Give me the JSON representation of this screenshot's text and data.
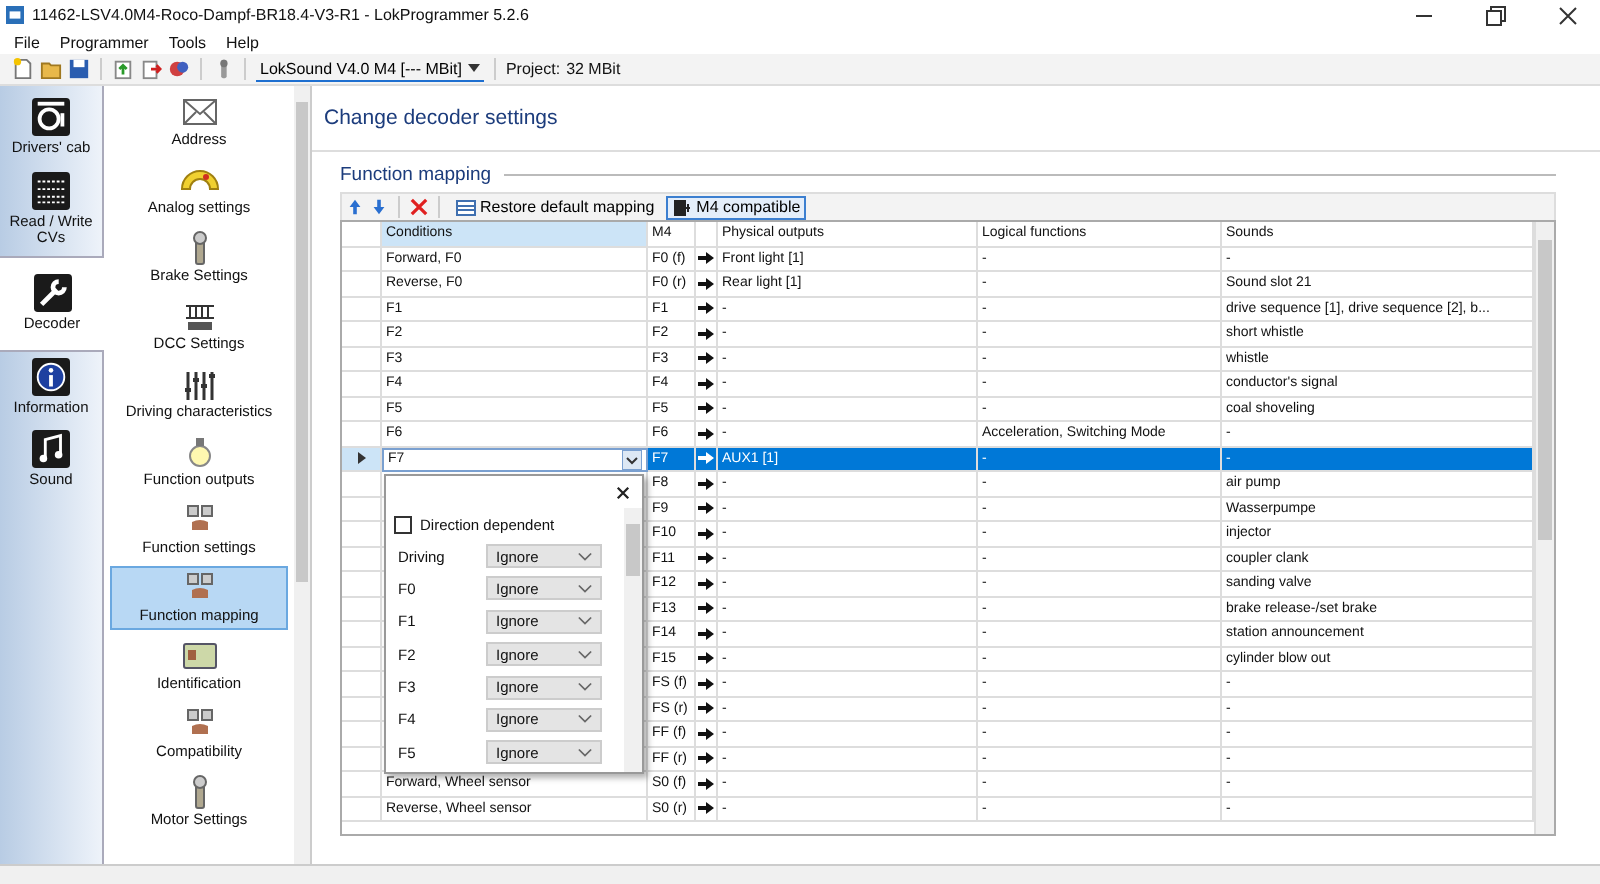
{
  "window": {
    "title": "11462-LSV4.0M4-Roco-Dampf-BR18.4-V3-R1 - LokProgrammer 5.2.6"
  },
  "menu": [
    "File",
    "Programmer",
    "Tools",
    "Help"
  ],
  "toolbar": {
    "decoder": "LokSound V4.0 M4 [--- MBit]",
    "project_label": "Project:",
    "project_value": "32 MBit"
  },
  "nav": [
    {
      "label": "Drivers' cab",
      "selected": false
    },
    {
      "label": "Read / Write CVs",
      "selected": false
    },
    {
      "label": "Decoder",
      "selected": true
    },
    {
      "label": "Information",
      "selected": false
    },
    {
      "label": "Sound",
      "selected": false
    }
  ],
  "categories": [
    {
      "label": "Address",
      "selected": false
    },
    {
      "label": "Analog settings",
      "selected": false
    },
    {
      "label": "Brake Settings",
      "selected": false
    },
    {
      "label": "DCC Settings",
      "selected": false
    },
    {
      "label": "Driving characteristics",
      "selected": false
    },
    {
      "label": "Function outputs",
      "selected": false
    },
    {
      "label": "Function settings",
      "selected": false
    },
    {
      "label": "Function mapping",
      "selected": true
    },
    {
      "label": "Identification",
      "selected": false
    },
    {
      "label": "Compatibility",
      "selected": false
    },
    {
      "label": "Motor Settings",
      "selected": false
    }
  ],
  "page_title": "Change decoder settings",
  "section_title": "Function mapping",
  "mapping_toolbar": {
    "restore": "Restore default mapping",
    "m4_compatible": {
      "label": "M4 compatible",
      "pressed": true
    }
  },
  "table": {
    "columns": [
      "Conditions",
      "M4",
      "Physical outputs",
      "Logical functions",
      "Sounds"
    ],
    "rows": [
      {
        "conditions": "Forward, F0",
        "m4": "F0 (f)",
        "physical": "Front light [1]",
        "logical": "-",
        "sounds": "-",
        "selected": false
      },
      {
        "conditions": "Reverse, F0",
        "m4": "F0 (r)",
        "physical": "Rear light [1]",
        "logical": "-",
        "sounds": "Sound slot 21",
        "selected": false
      },
      {
        "conditions": "F1",
        "m4": "F1",
        "physical": "-",
        "logical": "-",
        "sounds": "drive sequence [1], drive sequence [2], b...",
        "selected": false
      },
      {
        "conditions": "F2",
        "m4": "F2",
        "physical": "-",
        "logical": "-",
        "sounds": "short whistle",
        "selected": false
      },
      {
        "conditions": "F3",
        "m4": "F3",
        "physical": "-",
        "logical": "-",
        "sounds": "whistle",
        "selected": false
      },
      {
        "conditions": "F4",
        "m4": "F4",
        "physical": "-",
        "logical": "-",
        "sounds": "conductor's signal",
        "selected": false
      },
      {
        "conditions": "F5",
        "m4": "F5",
        "physical": "-",
        "logical": "-",
        "sounds": "coal shoveling",
        "selected": false
      },
      {
        "conditions": "F6",
        "m4": "F6",
        "physical": "-",
        "logical": "Acceleration, Switching Mode",
        "sounds": "-",
        "selected": false
      },
      {
        "conditions": "F7",
        "m4": "F7",
        "physical": "AUX1 [1]",
        "logical": "-",
        "sounds": "-",
        "selected": true
      },
      {
        "m4": "F8",
        "physical": "-",
        "logical": "-",
        "sounds": "air pump",
        "selected": false
      },
      {
        "m4": "F9",
        "physical": "-",
        "logical": "-",
        "sounds": "Wasserpumpe",
        "selected": false
      },
      {
        "m4": "F10",
        "physical": "-",
        "logical": "-",
        "sounds": "injector",
        "selected": false
      },
      {
        "m4": "F11",
        "physical": "-",
        "logical": "-",
        "sounds": "coupler clank",
        "selected": false
      },
      {
        "m4": "F12",
        "physical": "-",
        "logical": "-",
        "sounds": "sanding valve",
        "selected": false
      },
      {
        "m4": "F13",
        "physical": "-",
        "logical": "-",
        "sounds": "brake release-/set brake",
        "selected": false
      },
      {
        "m4": "F14",
        "physical": "-",
        "logical": "-",
        "sounds": "station announcement",
        "selected": false
      },
      {
        "m4": "F15",
        "physical": "-",
        "logical": "-",
        "sounds": "cylinder blow out",
        "selected": false
      },
      {
        "m4": "FS (f)",
        "physical": "-",
        "logical": "-",
        "sounds": "-",
        "selected": false
      },
      {
        "m4": "FS (r)",
        "physical": "-",
        "logical": "-",
        "sounds": "-",
        "selected": false
      },
      {
        "m4": "FF (f)",
        "physical": "-",
        "logical": "-",
        "sounds": "-",
        "selected": false
      },
      {
        "m4": "FF (r)",
        "physical": "-",
        "logical": "-",
        "sounds": "-",
        "selected": false
      },
      {
        "conditions": "Forward, Wheel sensor",
        "m4": "S0 (f)",
        "physical": "-",
        "logical": "-",
        "sounds": "-",
        "selected": false
      },
      {
        "conditions": "Reverse, Wheel sensor",
        "m4": "S0 (r)",
        "physical": "-",
        "logical": "-",
        "sounds": "-",
        "selected": false
      }
    ]
  },
  "popup": {
    "direction_dependent": {
      "label": "Direction dependent",
      "checked": false
    },
    "conditions": [
      {
        "label": "Driving",
        "value": "Ignore"
      },
      {
        "label": "F0",
        "value": "Ignore"
      },
      {
        "label": "F1",
        "value": "Ignore"
      },
      {
        "label": "F2",
        "value": "Ignore"
      },
      {
        "label": "F3",
        "value": "Ignore"
      },
      {
        "label": "F4",
        "value": "Ignore"
      },
      {
        "label": "F5",
        "value": "Ignore"
      }
    ]
  }
}
